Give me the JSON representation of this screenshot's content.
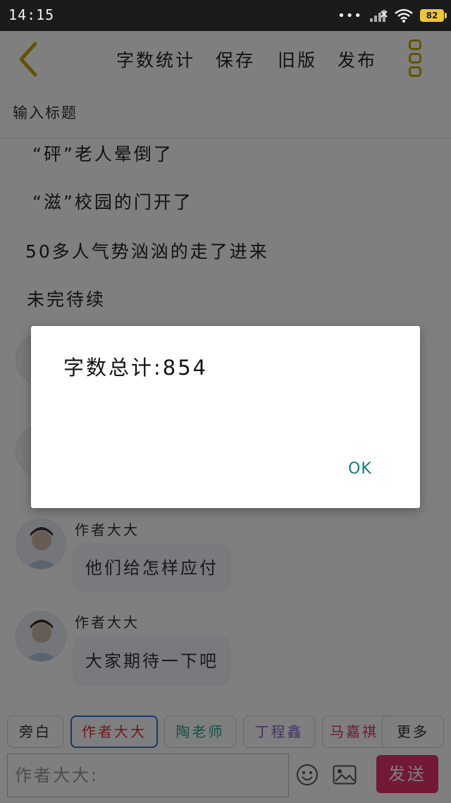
{
  "status_bar": {
    "time": "14:15",
    "battery": "82",
    "icons": [
      "more-dots-icon",
      "signal-icon",
      "wifi-icon",
      "battery-icon"
    ]
  },
  "toolbar": {
    "back_icon": "back-arrow-icon",
    "word_count_label": "字数统计",
    "save_label": "保存",
    "old_version_label": "旧版",
    "publish_label": "发布",
    "more_icon": "more-vertical-icon",
    "accent": "#c8a500"
  },
  "title_field": {
    "placeholder": "输入标题"
  },
  "story": {
    "narration": [
      "“砰”老人晕倒了",
      "“滋”校园的门开了",
      "50多人气势汹汹的走了进来",
      "未完待续"
    ],
    "messages": [
      {
        "speaker": "作者大大",
        "text": "他们给怎样应付"
      },
      {
        "speaker": "作者大大",
        "text": "大家期待一下吧"
      }
    ]
  },
  "roles": [
    {
      "label": "旁白",
      "color": "#333333"
    },
    {
      "label": "作者大大",
      "color": "#e0303a"
    },
    {
      "label": "陶老师",
      "color": "#2f9e8f"
    },
    {
      "label": "丁程鑫",
      "color": "#8a5fc8"
    },
    {
      "label": "马嘉祺",
      "color": "#e0306a"
    },
    {
      "label": "更多",
      "color": "#333333"
    }
  ],
  "input": {
    "placeholder": "作者大大:",
    "emoji_icon": "emoji-icon",
    "image_icon": "image-icon",
    "send_label": "发送",
    "send_color": "#e6336a"
  },
  "dialog": {
    "message": "字数总计:854",
    "ok_label": "OK"
  }
}
